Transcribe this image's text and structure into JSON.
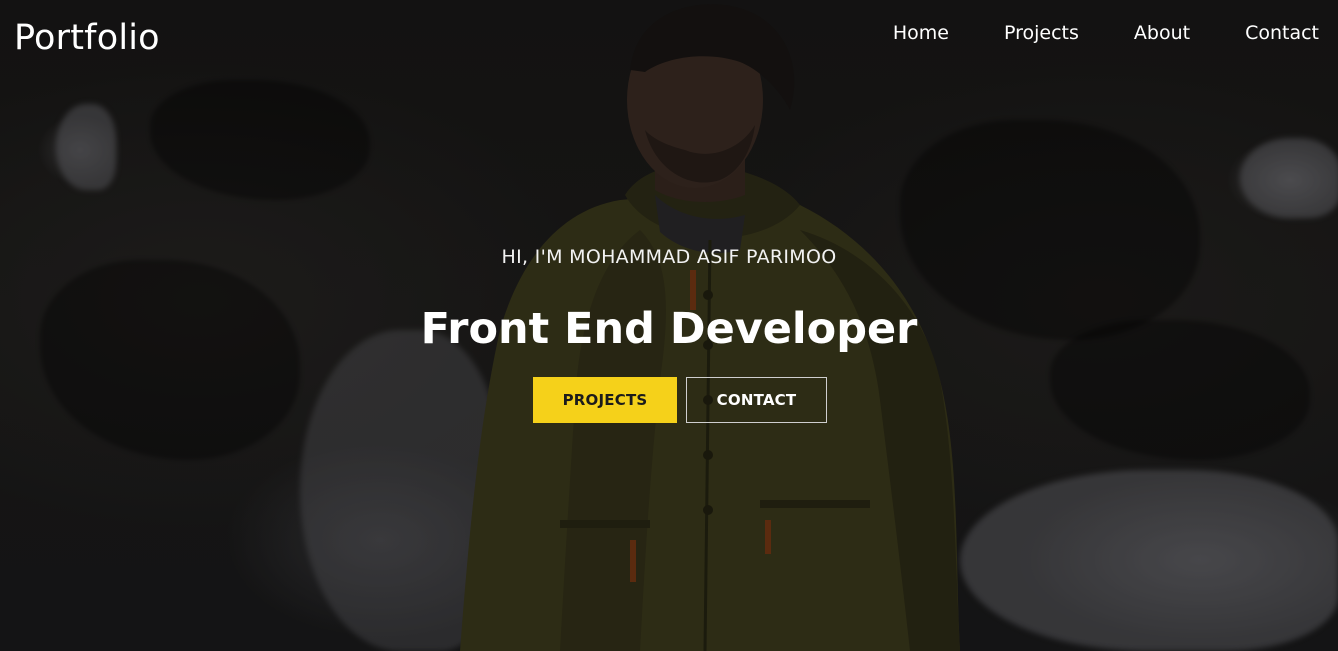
{
  "brand": {
    "logo_text": "Portfolio"
  },
  "nav": {
    "items": [
      {
        "label": "Home"
      },
      {
        "label": "Projects"
      },
      {
        "label": "About"
      },
      {
        "label": "Contact"
      }
    ]
  },
  "hero": {
    "intro": "HI, I'M MOHAMMAD ASIF PARIMOO",
    "headline": "Front End Developer",
    "primary_button": "PROJECTS",
    "secondary_button": "CONTACT"
  },
  "colors": {
    "accent": "#f5d11a",
    "text": "#ffffff",
    "background": "#1a1918"
  }
}
